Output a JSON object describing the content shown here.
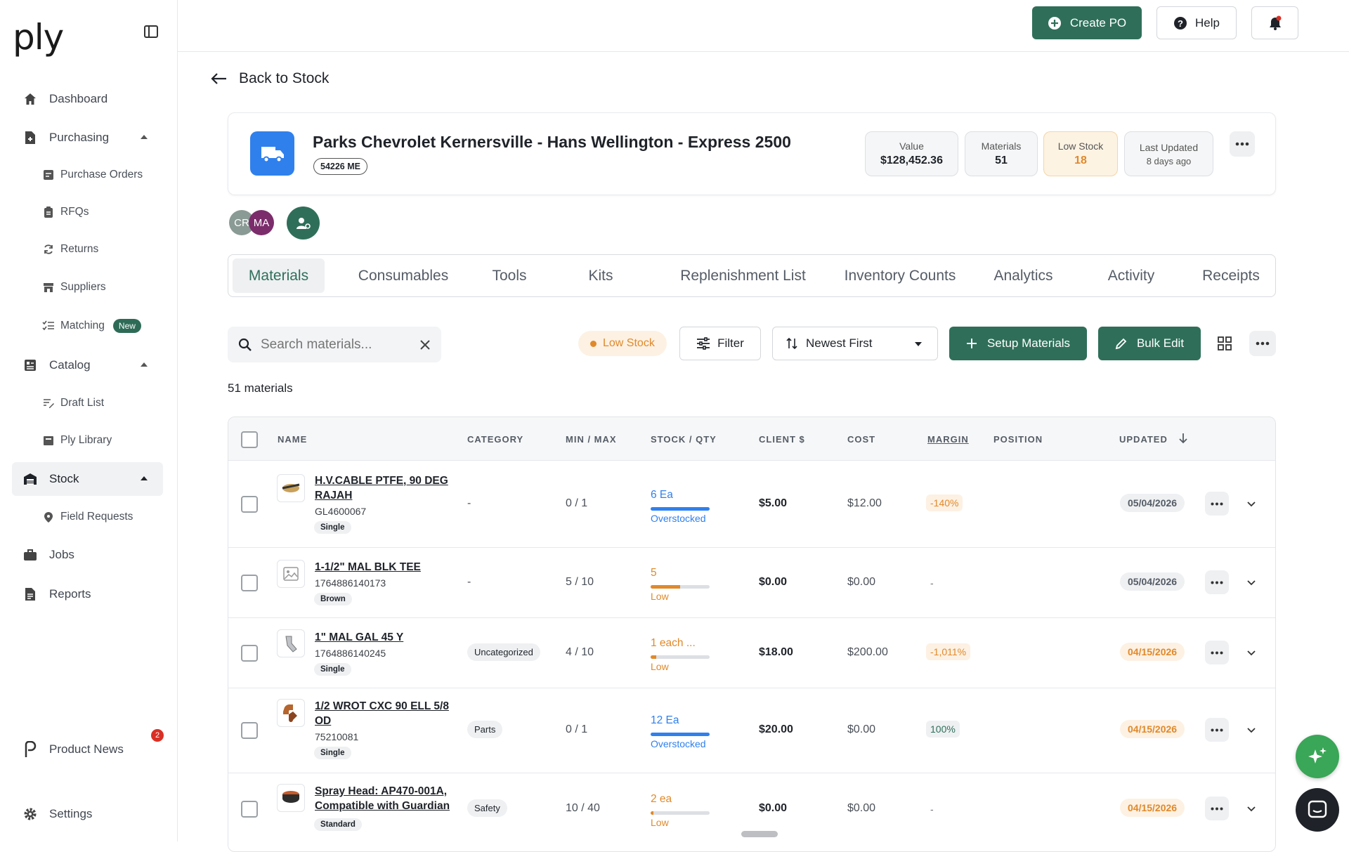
{
  "app": {
    "logo": "ply"
  },
  "sidebar": {
    "items": [
      {
        "label": "Dashboard",
        "icon": "home-icon"
      },
      {
        "label": "Purchasing",
        "icon": "document-plus-icon"
      },
      {
        "label": "Purchase Orders",
        "icon": "list-check-icon"
      },
      {
        "label": "RFQs",
        "icon": "clipboard-icon"
      },
      {
        "label": "Returns",
        "icon": "refresh-icon"
      },
      {
        "label": "Suppliers",
        "icon": "store-icon"
      },
      {
        "label": "Matching",
        "icon": "checklist-icon",
        "badge": "New"
      },
      {
        "label": "Catalog",
        "icon": "catalog-icon"
      },
      {
        "label": "Draft List",
        "icon": "edit-list-icon"
      },
      {
        "label": "Ply Library",
        "icon": "library-icon"
      },
      {
        "label": "Stock",
        "icon": "warehouse-icon"
      },
      {
        "label": "Field Requests",
        "icon": "location-pin-icon"
      },
      {
        "label": "Jobs",
        "icon": "briefcase-icon"
      },
      {
        "label": "Reports",
        "icon": "report-icon"
      },
      {
        "label": "Product News",
        "icon": "ply-logo-icon",
        "badge": "2"
      },
      {
        "label": "Settings",
        "icon": "gear-icon"
      }
    ]
  },
  "topbar": {
    "create_po": "Create PO",
    "help": "Help"
  },
  "back_label": "Back to Stock",
  "header": {
    "title": "Parks Chevrolet Kernersville - Hans Wellington - Express 2500",
    "code": "54226 ME",
    "stats": [
      {
        "label": "Value",
        "value": "$128,452.36"
      },
      {
        "label": "Materials",
        "value": "51"
      },
      {
        "label": "Low Stock",
        "value": "18"
      },
      {
        "label": "Last Updated",
        "value": "8 days ago"
      }
    ]
  },
  "avatars": [
    {
      "initials": "CR",
      "color": "#8a9a94"
    },
    {
      "initials": "MA",
      "color": "#7b2d6b"
    }
  ],
  "tabs": [
    "Materials",
    "Consumables",
    "Tools",
    "Kits",
    "Replenishment List",
    "Inventory Counts",
    "Analytics",
    "Activity",
    "Receipts"
  ],
  "toolbar": {
    "search_placeholder": "Search materials...",
    "low_stock_chip": "Low Stock",
    "filter": "Filter",
    "sort": "Newest First",
    "setup": "Setup Materials",
    "bulk_edit": "Bulk Edit"
  },
  "count_label": "51 materials",
  "table": {
    "columns": [
      "NAME",
      "CATEGORY",
      "MIN / MAX",
      "STOCK / QTY",
      "CLIENT $",
      "COST",
      "MARGIN",
      "POSITION",
      "UPDATED"
    ],
    "rows": [
      {
        "name": "H.V.CABLE PTFE, 90 DEG RAJAH",
        "sku": "GL4600067",
        "tag": "Single",
        "category": "-",
        "minmax": "0 / 1",
        "stock": "6 Ea",
        "stock_fill": 1.0,
        "status": "Overstocked",
        "client": "$5.00",
        "cost": "$12.00",
        "margin": "-140%",
        "updated": "05/04/2026"
      },
      {
        "name": "1-1/2\" MAL BLK TEE",
        "sku": "1764886140173",
        "tag": "Brown",
        "category": "-",
        "minmax": "5 / 10",
        "stock": "5",
        "stock_fill": 0.5,
        "status": "Low",
        "client": "$0.00",
        "cost": "$0.00",
        "margin": "-",
        "updated": "05/04/2026"
      },
      {
        "name": "1\" MAL GAL 45 Y",
        "sku": "1764886140245",
        "tag": "Single",
        "category": "Uncategorized",
        "minmax": "4 / 10",
        "stock": "1 each ...",
        "stock_fill": 0.1,
        "status": "Low",
        "client": "$18.00",
        "cost": "$200.00",
        "margin": "-1,011%",
        "updated": "04/15/2026"
      },
      {
        "name": "1/2 WROT CXC 90 ELL 5/8 OD",
        "sku": "75210081",
        "tag": "Single",
        "category": "Parts",
        "minmax": "0 / 1",
        "stock": "12 Ea",
        "stock_fill": 1.0,
        "status": "Overstocked",
        "client": "$20.00",
        "cost": "$0.00",
        "margin": "100%",
        "updated": "04/15/2026"
      },
      {
        "name": "Spray Head: AP470-001A, Compatible with Guardian",
        "sku": "",
        "tag": "Standard",
        "category": "Safety",
        "minmax": "10 / 40",
        "stock": "2 ea",
        "stock_fill": 0.05,
        "status": "Low",
        "client": "$0.00",
        "cost": "$0.00",
        "margin": "-",
        "updated": "04/15/2026"
      }
    ]
  },
  "colors": {
    "accent": "#2f6f5a",
    "warn": "#e0892a",
    "info": "#2f80ed"
  }
}
